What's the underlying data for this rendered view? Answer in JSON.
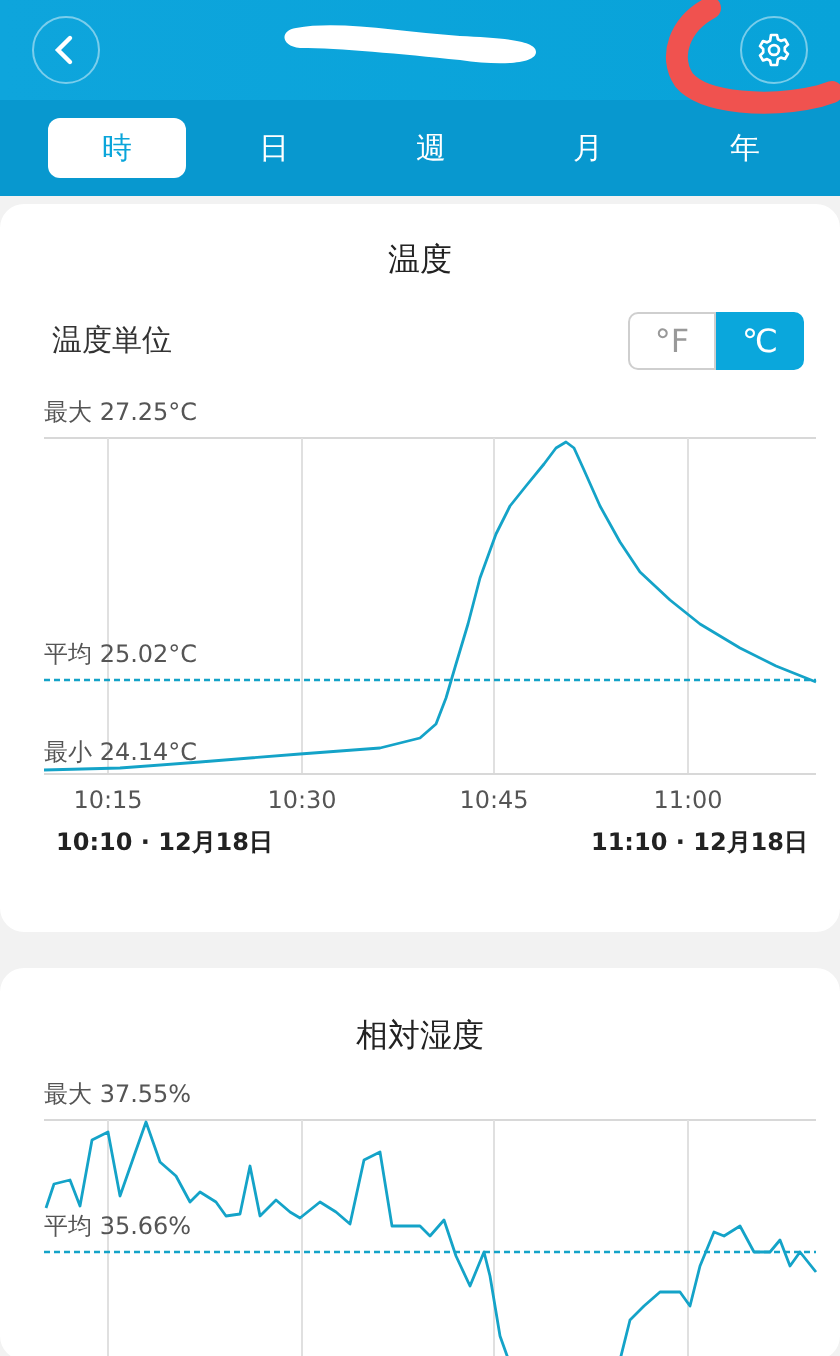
{
  "tabs": [
    {
      "label": "時",
      "selected": true
    },
    {
      "label": "日",
      "selected": false
    },
    {
      "label": "週",
      "selected": false
    },
    {
      "label": "月",
      "selected": false
    },
    {
      "label": "年",
      "selected": false
    }
  ],
  "overlay_marks": [
    {
      "kind": "scribble"
    },
    {
      "kind": "circle",
      "color": "#f0524f"
    }
  ],
  "temperature_card": {
    "title": "温度",
    "unit_label": "温度単位",
    "unit_options": [
      {
        "label": "°F",
        "selected": false
      },
      {
        "label": "℃",
        "selected": true
      }
    ],
    "chart": {
      "max_label": "最大 27.25°C",
      "avg_label": "平均 25.02°C",
      "min_label": "最小 24.14°C",
      "time_labels": [
        "10:15",
        "10:30",
        "10:45",
        "11:00"
      ],
      "start_label": "10:10 · 12月18日",
      "end_label": "11:10 · 12月18日"
    }
  },
  "humidity_card": {
    "title": "相対湿度",
    "chart": {
      "max_label": "最大 37.55%",
      "avg_label": "平均 35.66%"
    }
  }
}
